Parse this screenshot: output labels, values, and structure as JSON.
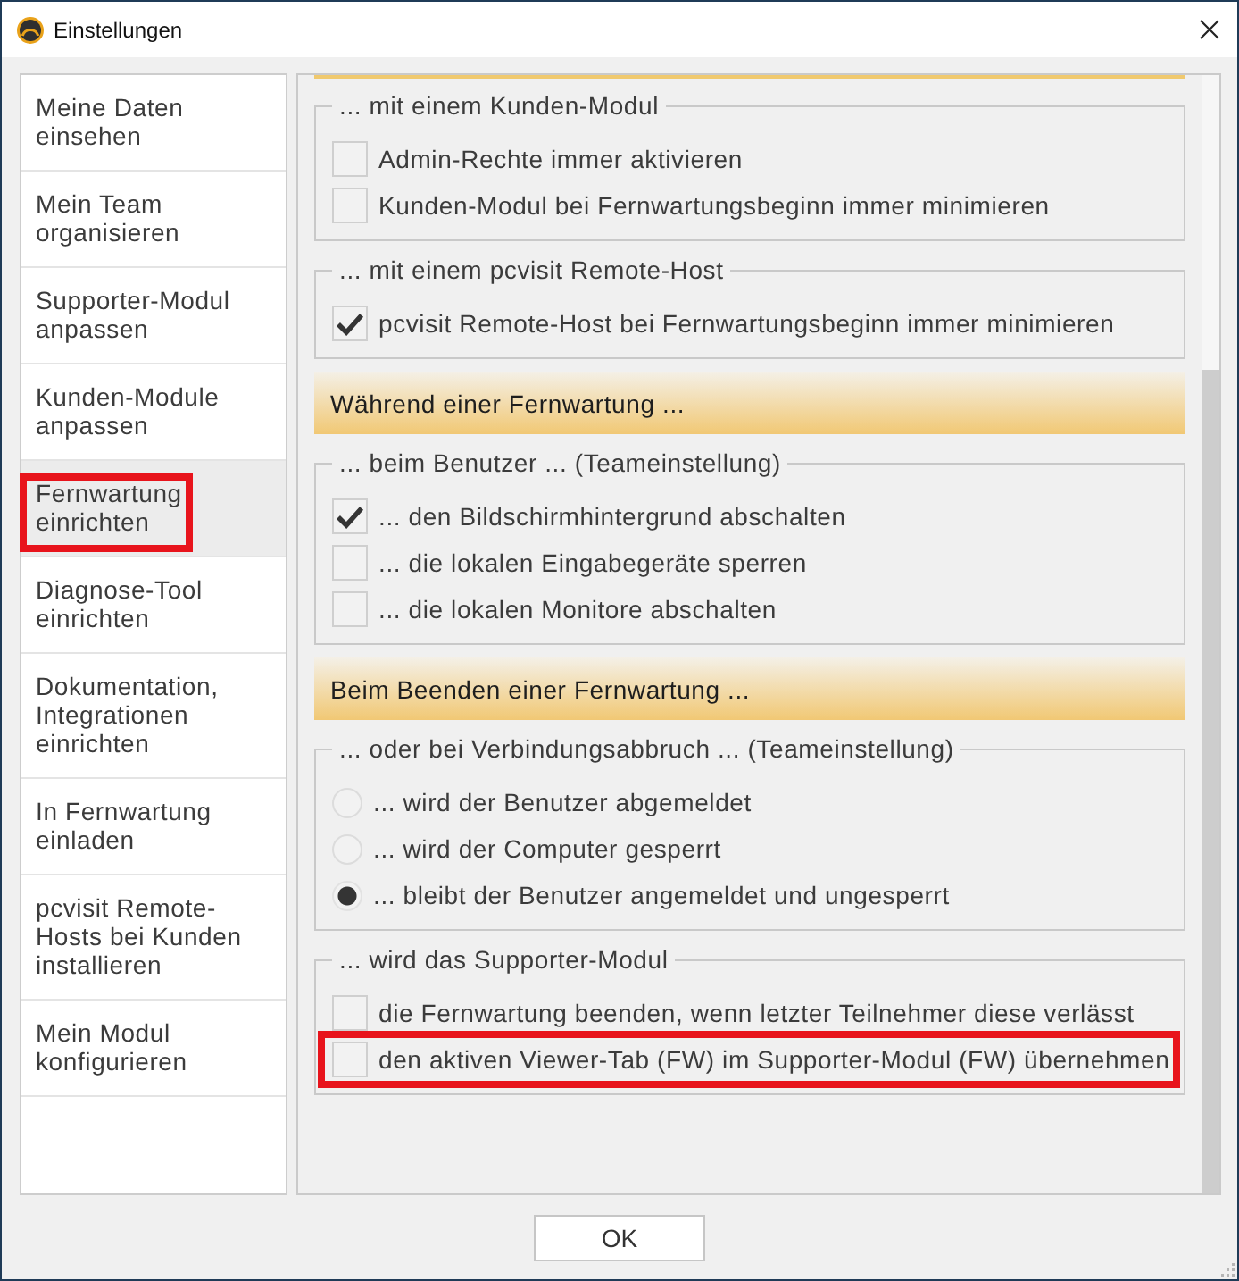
{
  "window": {
    "title": "Einstellungen"
  },
  "sidebar": {
    "items": [
      {
        "label": "Meine Daten einsehen",
        "selected": false,
        "highlighted": false
      },
      {
        "label": "Mein Team organisieren",
        "selected": false,
        "highlighted": false
      },
      {
        "label": "Supporter-Modul anpassen",
        "selected": false,
        "highlighted": false
      },
      {
        "label": "Kunden-Module anpassen",
        "selected": false,
        "highlighted": false
      },
      {
        "label": "Fernwartung einrichten",
        "selected": true,
        "highlighted": true
      },
      {
        "label": "Diagnose-Tool einrichten",
        "selected": false,
        "highlighted": false
      },
      {
        "label": "Dokumentation, Integrationen einrichten",
        "selected": false,
        "highlighted": false
      },
      {
        "label": "In Fernwartung einladen",
        "selected": false,
        "highlighted": false
      },
      {
        "label": "pcvisit Remote-Hosts bei Kunden installieren",
        "selected": false,
        "highlighted": false
      },
      {
        "label": "Mein Modul konfigurieren",
        "selected": false,
        "highlighted": false
      }
    ]
  },
  "panel": {
    "sections": [
      {
        "kind": "group",
        "title": "... mit einem Kunden-Modul",
        "options": [
          {
            "kind": "checkbox",
            "label": "Admin-Rechte immer aktivieren",
            "checked": false,
            "highlighted": false
          },
          {
            "kind": "checkbox",
            "label": "Kunden-Modul bei Fernwartungsbeginn immer minimieren",
            "checked": false,
            "highlighted": false
          }
        ]
      },
      {
        "kind": "group",
        "title": "... mit einem pcvisit Remote-Host",
        "options": [
          {
            "kind": "checkbox",
            "label": "pcvisit Remote-Host bei Fernwartungsbeginn immer minimieren",
            "checked": true,
            "highlighted": false
          }
        ]
      },
      {
        "kind": "header",
        "title": "Während einer Fernwartung ..."
      },
      {
        "kind": "group",
        "title": "... beim Benutzer ... (Teameinstellung)",
        "options": [
          {
            "kind": "checkbox",
            "label": "... den Bildschirmhintergrund abschalten",
            "checked": true,
            "highlighted": false
          },
          {
            "kind": "checkbox",
            "label": "... die lokalen Eingabegeräte sperren",
            "checked": false,
            "highlighted": false
          },
          {
            "kind": "checkbox",
            "label": "... die lokalen Monitore abschalten",
            "checked": false,
            "highlighted": false
          }
        ]
      },
      {
        "kind": "header",
        "title": "Beim Beenden einer Fernwartung ..."
      },
      {
        "kind": "group",
        "title": "... oder bei Verbindungsabbruch ... (Teameinstellung)",
        "options": [
          {
            "kind": "radio",
            "label": "... wird der Benutzer abgemeldet",
            "selected": false,
            "highlighted": false
          },
          {
            "kind": "radio",
            "label": "... wird der Computer gesperrt",
            "selected": false,
            "highlighted": false
          },
          {
            "kind": "radio",
            "label": "... bleibt der Benutzer angemeldet und ungesperrt",
            "selected": true,
            "highlighted": false
          }
        ]
      },
      {
        "kind": "group",
        "title": "... wird das Supporter-Modul",
        "options": [
          {
            "kind": "checkbox",
            "label": "die Fernwartung beenden, wenn letzter Teilnehmer diese verlässt",
            "checked": false,
            "highlighted": false
          },
          {
            "kind": "checkbox",
            "label": "den aktiven Viewer-Tab (FW) im Supporter-Modul (FW) übernehmen",
            "checked": false,
            "highlighted": true
          }
        ]
      }
    ]
  },
  "buttons": [
    {
      "label": "OK"
    }
  ]
}
